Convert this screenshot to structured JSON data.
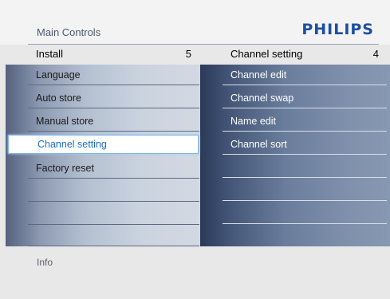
{
  "header": {
    "title": "Main Controls",
    "brand": "PHILIPS",
    "brand_color": "#1c4fa0"
  },
  "left_menu": {
    "title": "Install",
    "count": "5",
    "items": [
      {
        "label": "Language"
      },
      {
        "label": "Auto store"
      },
      {
        "label": "Manual store"
      },
      {
        "label": "Channel setting",
        "selected": true
      },
      {
        "label": "Factory reset"
      },
      {
        "label": ""
      },
      {
        "label": ""
      },
      {
        "label": ""
      }
    ]
  },
  "right_menu": {
    "title": "Channel setting",
    "count": "4",
    "items": [
      {
        "label": "Channel edit"
      },
      {
        "label": "Channel swap"
      },
      {
        "label": "Name edit"
      },
      {
        "label": "Channel sort"
      },
      {
        "label": ""
      },
      {
        "label": ""
      },
      {
        "label": ""
      },
      {
        "label": ""
      }
    ]
  },
  "footer": {
    "info_label": "Info"
  },
  "colors": {
    "selection_text": "#1b6fc2",
    "selection_border": "#7fb6e4"
  }
}
